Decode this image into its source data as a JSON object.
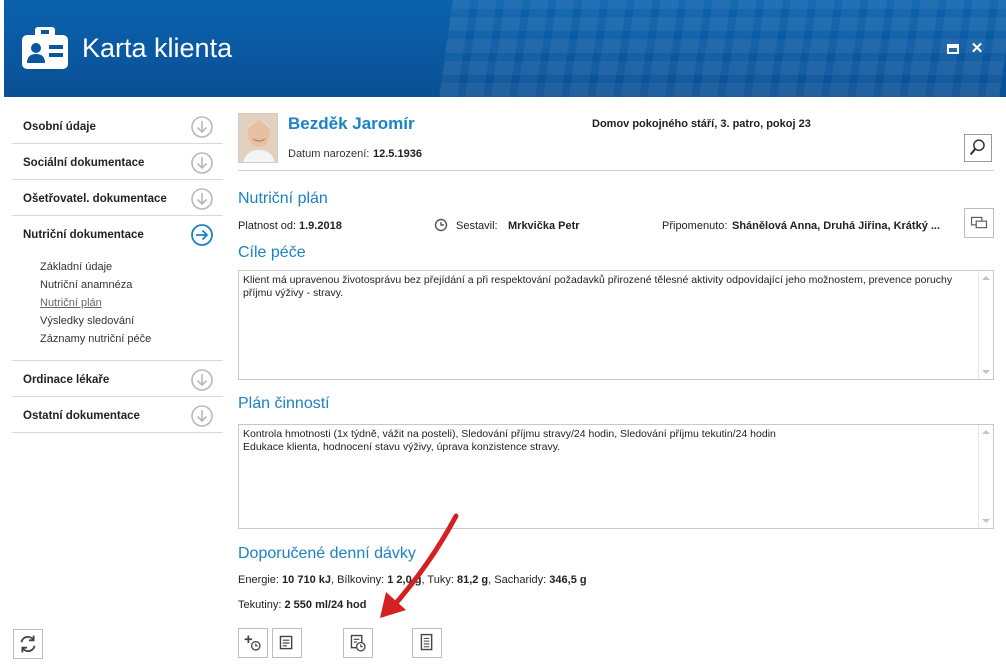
{
  "header": {
    "title": "Karta klienta"
  },
  "sidebar": {
    "items": [
      {
        "label": "Osobní údaje"
      },
      {
        "label": "Sociální dokumentace"
      },
      {
        "label": "Ošetřovatel. dokumentace"
      },
      {
        "label": "Nutriční dokumentace",
        "active": true
      },
      {
        "label": "Ordinace lékaře"
      },
      {
        "label": "Ostatní dokumentace"
      }
    ],
    "subitems": [
      {
        "label": "Základní údaje"
      },
      {
        "label": "Nutriční anamnéza"
      },
      {
        "label": "Nutriční plán",
        "active": true
      },
      {
        "label": "Výsledky sledování"
      },
      {
        "label": "Záznamy nutriční péče"
      }
    ]
  },
  "client": {
    "name": "Bezděk Jaromír",
    "dob_label": "Datum narození:",
    "dob": "12.5.1936",
    "location": "Domov pokojného stáří, 3. patro, pokoj 23"
  },
  "plan": {
    "title": "Nutriční plán",
    "validity_label": "Platnost od:",
    "validity": "1.9.2018",
    "author_label": "Sestavil:",
    "author": "Mrkvička Petr",
    "reminded_label": "Připomenuto:",
    "reminded": "Shánělová Anna, Druhá Jiřina, Krátký ..."
  },
  "goals": {
    "title": "Cíle péče",
    "text": "Klient má upravenou životosprávu bez přejídání a při respektování požadavků přirozené tělesné aktivity odpovídající jeho možnostem, prevence poruchy příjmu výživy - stravy."
  },
  "activities": {
    "title": "Plán činností",
    "line1": "Kontrola hmotnosti (1x týdně, vážit na posteli), Sledování příjmu stravy/24 hodin, Sledování příjmu tekutin/24 hodin",
    "line2": "Edukace klienta, hodnocení stavu výživy, úprava konzistence stravy."
  },
  "doses": {
    "title": "Doporučené denní dávky",
    "energy_label": "Energie:",
    "energy": "10 710 kJ",
    "protein_label": ", Bílkoviny:",
    "protein": "1 2,0 g",
    "fat_label": ", Tuky:",
    "fat": "81,2 g",
    "carbs_label": ", Sacharidy:",
    "carbs": "346,5 g",
    "fluids_label": "Tekutiny:",
    "fluids": "2 550 ml/24 hod"
  },
  "colors": {
    "header": "#0a57a0",
    "accent": "#1b82c5",
    "arrow": "#d42020"
  }
}
